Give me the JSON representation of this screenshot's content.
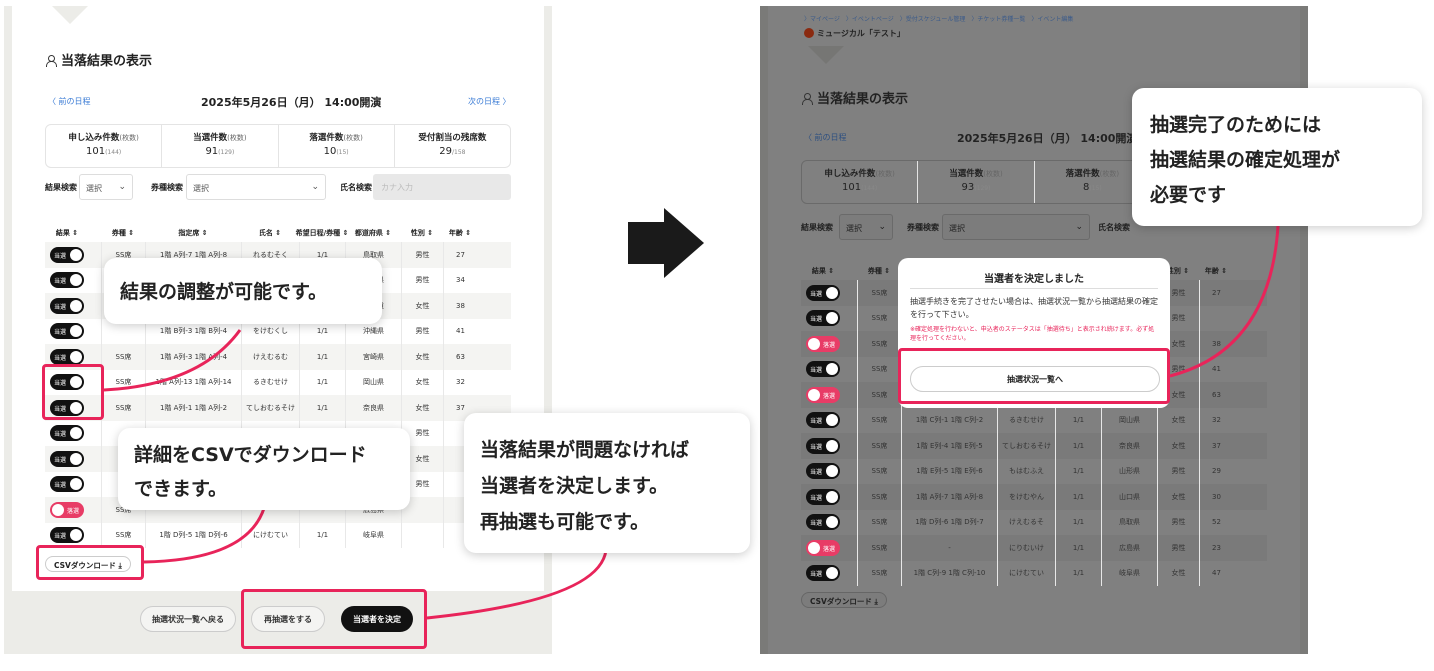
{
  "left": {
    "title": "当落結果の表示",
    "prev": "〈 前の日程",
    "next": "次の日程 〉",
    "date": "2025年5月26日（月） 14:00開演",
    "stats": [
      {
        "label": "申し込み件数",
        "unit": "(枚数)",
        "value": "101",
        "sub": "(144)"
      },
      {
        "label": "当選件数",
        "unit": "(枚数)",
        "value": "91",
        "sub": "(129)"
      },
      {
        "label": "落選件数",
        "unit": "(枚数)",
        "value": "10",
        "sub": "(15)"
      },
      {
        "label": "受付割当の残席数",
        "unit": "",
        "value": "29",
        "sub": "/158"
      }
    ],
    "filter": {
      "result_label": "結果検索",
      "result_value": "選択",
      "seat_label": "券種検索",
      "seat_value": "選択",
      "name_label": "氏名検索",
      "name_placeholder": "カナ入力"
    },
    "headers": [
      "結果 ⇕",
      "券種 ⇕",
      "指定席 ⇕",
      "氏名 ⇕",
      "希望日程/券種 ⇕",
      "都道府県 ⇕",
      "性別 ⇕",
      "年齢 ⇕"
    ],
    "rows": [
      {
        "r": "当選",
        "on": true,
        "seat": "SS席",
        "spec": "1階 A列-7 1階 A列-8",
        "name": "れるむそく",
        "pref": "1/1",
        "area": "鳥取県",
        "sex": "男性",
        "age": "27"
      },
      {
        "r": "当選",
        "on": true,
        "seat": "",
        "spec": "",
        "name": "",
        "pref": "",
        "area": "沖縄県",
        "sex": "男性",
        "age": "34"
      },
      {
        "r": "当選",
        "on": true,
        "seat": "",
        "spec": "",
        "name": "",
        "pref": "",
        "area": "北海道",
        "sex": "女性",
        "age": "38"
      },
      {
        "r": "当選",
        "on": true,
        "seat": "",
        "spec": "1階 B列-3 1階 B列-4",
        "name": "をけむくし",
        "pref": "1/1",
        "area": "沖縄県",
        "sex": "男性",
        "age": "41"
      },
      {
        "r": "当選",
        "on": true,
        "seat": "SS席",
        "spec": "1階 A列-3 1階 A列-4",
        "name": "けえむるむ",
        "pref": "1/1",
        "area": "宮崎県",
        "sex": "女性",
        "age": "63"
      },
      {
        "r": "当選",
        "on": true,
        "seat": "SS席",
        "spec": "1階 A列-13 1階 A列-14",
        "name": "るきむせけ",
        "pref": "1/1",
        "area": "岡山県",
        "sex": "女性",
        "age": "32"
      },
      {
        "r": "当選",
        "on": true,
        "seat": "SS席",
        "spec": "1階 A列-1 1階 A列-2",
        "name": "てしおむるそけ",
        "pref": "1/1",
        "area": "奈良県",
        "sex": "女性",
        "age": "37"
      },
      {
        "r": "当選",
        "on": true,
        "seat": "",
        "spec": "",
        "name": "",
        "pref": "",
        "area": "山形県",
        "sex": "男性",
        "age": ""
      },
      {
        "r": "当選",
        "on": true,
        "seat": "",
        "spec": "",
        "name": "",
        "pref": "",
        "area": "山口県",
        "sex": "女性",
        "age": ""
      },
      {
        "r": "当選",
        "on": true,
        "seat": "",
        "spec": "",
        "name": "",
        "pref": "",
        "area": "山口県",
        "sex": "男性",
        "age": ""
      },
      {
        "r": "落選",
        "on": false,
        "seat": "SS席",
        "spec": "",
        "name": "",
        "pref": "",
        "area": "広島県",
        "sex": "",
        "age": ""
      },
      {
        "r": "当選",
        "on": true,
        "seat": "SS席",
        "spec": "1階 D列-5 1階 D列-6",
        "name": "にけむてい",
        "pref": "1/1",
        "area": "岐阜県",
        "sex": "",
        "age": ""
      }
    ],
    "csv": "CSVダウンロード ⤓",
    "btn_back": "抽選状況一覧へ戻る",
    "btn_redraw": "再抽選をする",
    "btn_decide": "当選者を決定"
  },
  "right": {
    "breadcrumb": "〉マイページ　〉イベントページ　〉受付スケジュール管理　〉チケット券種一覧　〉イベント編集",
    "event": "ミュージカル「テスト」",
    "title": "当落結果の表示",
    "prev": "〈 前の日程",
    "date": "2025年5月26日（月） 14:00開演",
    "stats": [
      {
        "label": "申し込み件数",
        "unit": "(枚数)",
        "value": "101",
        "sub": "(144)"
      },
      {
        "label": "当選件数",
        "unit": "(枚数)",
        "value": "93",
        "sub": "(129)"
      },
      {
        "label": "落選件数",
        "unit": "(枚数)",
        "value": "8",
        "sub": "(15)"
      }
    ],
    "filter": {
      "result_label": "結果検索",
      "result_value": "選択",
      "seat_label": "券種検索",
      "seat_value": "選択",
      "name_label": "氏名検索"
    },
    "headers": [
      "結果 ⇕",
      "券種 ⇕",
      "",
      "",
      "",
      "",
      "性別 ⇕",
      "年齢 ⇕"
    ],
    "rows": [
      {
        "r": "当選",
        "on": true,
        "seat": "SS席",
        "spec": "",
        "name": "",
        "pref": "",
        "area": "",
        "sex": "男性",
        "age": "27"
      },
      {
        "r": "当選",
        "on": true,
        "seat": "SS席",
        "spec": "",
        "name": "",
        "pref": "",
        "area": "",
        "sex": "男性",
        "age": ""
      },
      {
        "r": "落選",
        "on": false,
        "seat": "SS席",
        "spec": "",
        "name": "",
        "pref": "",
        "area": "",
        "sex": "女性",
        "age": "38"
      },
      {
        "r": "当選",
        "on": true,
        "seat": "SS席",
        "spec": "",
        "name": "",
        "pref": "",
        "area": "",
        "sex": "男性",
        "age": "41"
      },
      {
        "r": "落選",
        "on": false,
        "seat": "SS席",
        "spec": "",
        "name": "",
        "pref": "",
        "area": "",
        "sex": "女性",
        "age": "63"
      },
      {
        "r": "当選",
        "on": true,
        "seat": "SS席",
        "spec": "1階 C列-1 1階 C列-2",
        "name": "るきむせけ",
        "pref": "1/1",
        "area": "岡山県",
        "sex": "女性",
        "age": "32"
      },
      {
        "r": "当選",
        "on": true,
        "seat": "SS席",
        "spec": "1階 E列-4 1階 E列-5",
        "name": "てしおむるそけ",
        "pref": "1/1",
        "area": "奈良県",
        "sex": "女性",
        "age": "37"
      },
      {
        "r": "当選",
        "on": true,
        "seat": "SS席",
        "spec": "1階 E列-5 1階 E列-6",
        "name": "もはむふえ",
        "pref": "1/1",
        "area": "山形県",
        "sex": "男性",
        "age": "29"
      },
      {
        "r": "当選",
        "on": true,
        "seat": "SS席",
        "spec": "1階 A列-7 1階 A列-8",
        "name": "をけむやん",
        "pref": "1/1",
        "area": "山口県",
        "sex": "女性",
        "age": "30"
      },
      {
        "r": "当選",
        "on": true,
        "seat": "SS席",
        "spec": "1階 D列-6 1階 D列-7",
        "name": "けえむるそ",
        "pref": "1/1",
        "area": "鳥取県",
        "sex": "男性",
        "age": "52"
      },
      {
        "r": "落選",
        "on": false,
        "seat": "SS席",
        "spec": "-",
        "name": "にりむいけ",
        "pref": "1/1",
        "area": "広島県",
        "sex": "男性",
        "age": "23"
      },
      {
        "r": "当選",
        "on": true,
        "seat": "SS席",
        "spec": "1階 C列-9 1階 C列-10",
        "name": "にけむてい",
        "pref": "1/1",
        "area": "岐阜県",
        "sex": "女性",
        "age": "47"
      }
    ],
    "csv": "CSVダウンロード ⤓",
    "modal": {
      "title": "当選者を決定しました",
      "body": "抽選手続きを完了させたい場合は、抽選状況一覧から抽選結果の確定を行って下さい。",
      "warn": "※確定処理を行わないと、申込者のステータスは「抽選待ち」と表示され続けます。必ず処理を行ってください。",
      "button": "抽選状況一覧へ"
    }
  },
  "callouts": {
    "adjust": "結果の調整が可能です。",
    "csv_1": "詳細をCSVでダウンロード",
    "csv_2": "できます。",
    "decide_1": "当落結果が問題なければ",
    "decide_2": "当選者を決定します。",
    "decide_3": "再抽選も可能です。",
    "confirm_1": "抽選完了のためには",
    "confirm_2": "抽選結果の確定処理が",
    "confirm_3": "必要です"
  },
  "colors": {
    "accent": "#e8245a",
    "toggle_on": "#111111",
    "toggle_off": "#e83c66"
  }
}
